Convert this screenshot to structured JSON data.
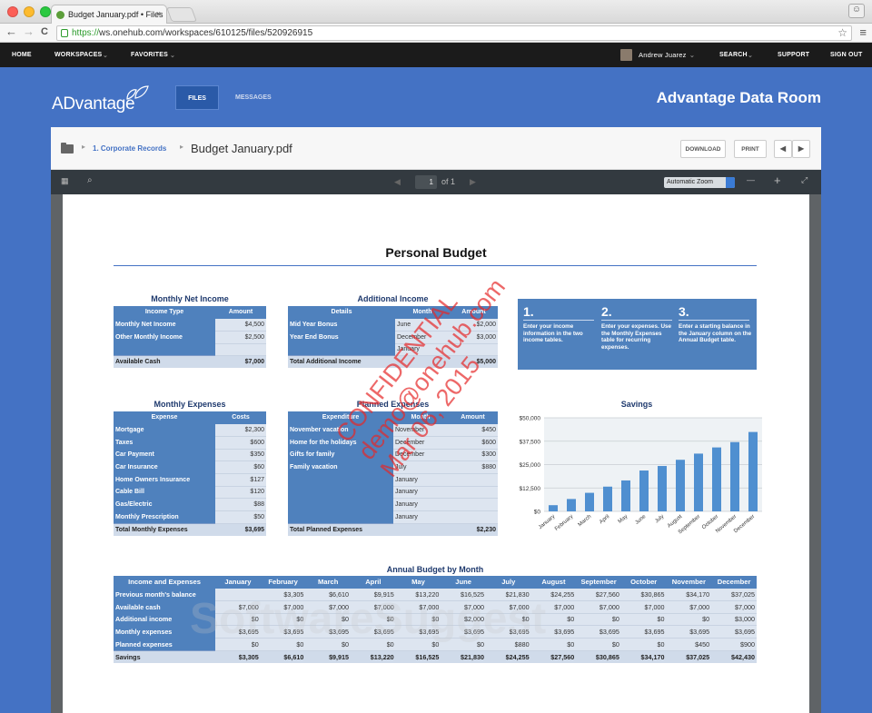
{
  "browser": {
    "tab_title": "Budget January.pdf • Files",
    "tab_close": "×",
    "url_https": "https://",
    "url_rest": "ws.onehub.com/workspaces/610125/files/520926915",
    "back": "←",
    "forward": "→",
    "reload": "C",
    "star": "☆",
    "menu": "≡"
  },
  "topnav": {
    "home": "HOME",
    "workspaces": "WORKSPACES",
    "favorites": "FAVORITES",
    "user": "Andrew Juarez",
    "search": "SEARCH",
    "support": "SUPPORT",
    "signout": "SIGN OUT"
  },
  "header": {
    "logo": "ADvantage",
    "files_tab": "FILES",
    "messages_tab": "MESSAGES",
    "room_title": "Advantage Data Room"
  },
  "breadcrumb": {
    "folder": "1. Corporate Records",
    "file": "Budget January.pdf",
    "download": "DOWNLOAD",
    "print": "PRINT",
    "prev": "◀",
    "next": "▶"
  },
  "pdf_toolbar": {
    "page": "1",
    "of": "of 1",
    "zoom": "Automatic Zoom",
    "minus": "—",
    "plus": "+"
  },
  "doc": {
    "title": "Personal Budget",
    "monthly_net_income": {
      "title": "Monthly Net Income",
      "headers": [
        "Income Type",
        "Amount"
      ],
      "rows": [
        [
          "Monthly Net Income",
          "$4,500"
        ],
        [
          "Other Monthly Income",
          "$2,500"
        ],
        [
          "",
          ""
        ]
      ],
      "total": [
        "Available Cash",
        "$7,000"
      ]
    },
    "additional_income": {
      "title": "Additional Income",
      "headers": [
        "Details",
        "Month",
        "Amount"
      ],
      "rows": [
        [
          "Mid Year Bonus",
          "June",
          "$2,000"
        ],
        [
          "Year End Bonus",
          "December",
          "$3,000"
        ],
        [
          "",
          "January",
          ""
        ]
      ],
      "total": [
        "Total Additional Income",
        "",
        "$5,000"
      ]
    },
    "steps": [
      {
        "num": "1.",
        "text": "Enter your income information in the two income tables."
      },
      {
        "num": "2.",
        "text": "Enter your expenses. Use the Monthly Expenses table for recurring expenses."
      },
      {
        "num": "3.",
        "text": "Enter a starting balance in the January column on the Annual Budget table."
      }
    ],
    "monthly_expenses": {
      "title": "Monthly Expenses",
      "headers": [
        "Expense",
        "Costs"
      ],
      "rows": [
        [
          "Mortgage",
          "$2,300"
        ],
        [
          "Taxes",
          "$600"
        ],
        [
          "Car Payment",
          "$350"
        ],
        [
          "Car Insurance",
          "$60"
        ],
        [
          "Home Owners Insurance",
          "$127"
        ],
        [
          "Cable Bill",
          "$120"
        ],
        [
          "Gas/Electric",
          "$88"
        ],
        [
          "Monthly Prescription",
          "$50"
        ]
      ],
      "total": [
        "Total Monthly Expenses",
        "$3,695"
      ]
    },
    "planned_expenses": {
      "title": "Planned Expenses",
      "headers": [
        "Expenditure",
        "Month",
        "Amount"
      ],
      "rows": [
        [
          "November vacation",
          "November",
          "$450"
        ],
        [
          "Home for the holidays",
          "December",
          "$600"
        ],
        [
          "Gifts for family",
          "December",
          "$300"
        ],
        [
          "Family vacation",
          "July",
          "$880"
        ],
        [
          "",
          "January",
          ""
        ],
        [
          "",
          "January",
          ""
        ],
        [
          "",
          "January",
          ""
        ],
        [
          "",
          "January",
          ""
        ]
      ],
      "total": [
        "Total Planned Expenses",
        "",
        "$2,230"
      ]
    },
    "annual": {
      "title": "Annual Budget by Month",
      "headers": [
        "Income and Expenses",
        "January",
        "February",
        "March",
        "April",
        "May",
        "June",
        "July",
        "August",
        "September",
        "October",
        "November",
        "December"
      ],
      "rows": [
        [
          "Previous month's balance",
          "",
          "$3,305",
          "$6,610",
          "$9,915",
          "$13,220",
          "$16,525",
          "$21,830",
          "$24,255",
          "$27,560",
          "$30,865",
          "$34,170",
          "$37,025"
        ],
        [
          "Available cash",
          "$7,000",
          "$7,000",
          "$7,000",
          "$7,000",
          "$7,000",
          "$7,000",
          "$7,000",
          "$7,000",
          "$7,000",
          "$7,000",
          "$7,000",
          "$7,000"
        ],
        [
          "Additional income",
          "$0",
          "$0",
          "$0",
          "$0",
          "$0",
          "$2,000",
          "$0",
          "$0",
          "$0",
          "$0",
          "$0",
          "$3,000"
        ],
        [
          "Monthly expenses",
          "$3,695",
          "$3,695",
          "$3,695",
          "$3,695",
          "$3,695",
          "$3,695",
          "$3,695",
          "$3,695",
          "$3,695",
          "$3,695",
          "$3,695",
          "$3,695"
        ],
        [
          "Planned expenses",
          "$0",
          "$0",
          "$0",
          "$0",
          "$0",
          "$0",
          "$880",
          "$0",
          "$0",
          "$0",
          "$450",
          "$900"
        ]
      ],
      "total": [
        "Savings",
        "$3,305",
        "$6,610",
        "$9,915",
        "$13,220",
        "$16,525",
        "$21,830",
        "$24,255",
        "$27,560",
        "$30,865",
        "$34,170",
        "$37,025",
        "$42,430"
      ]
    }
  },
  "chart_data": {
    "type": "bar",
    "title": "Savings",
    "categories": [
      "January",
      "February",
      "March",
      "April",
      "May",
      "June",
      "July",
      "August",
      "September",
      "October",
      "November",
      "December"
    ],
    "values": [
      3305,
      6610,
      9915,
      13220,
      16525,
      21830,
      24255,
      27560,
      30865,
      34170,
      37025,
      42430
    ],
    "yticks": [
      "$50,000",
      "$37,500",
      "$25,000",
      "$12,500",
      "$0"
    ],
    "ylim": [
      0,
      50000
    ],
    "bar_color": "#4f8fd0",
    "grid": true
  },
  "watermark": {
    "lines": [
      "CONFIDENTIAL",
      "demo@onehub.com",
      "Mar 06, 2015"
    ],
    "brand": "SoftwareSuggest"
  },
  "colors": {
    "brand_blue": "#4472c4",
    "table_blue": "#4f81bd"
  }
}
